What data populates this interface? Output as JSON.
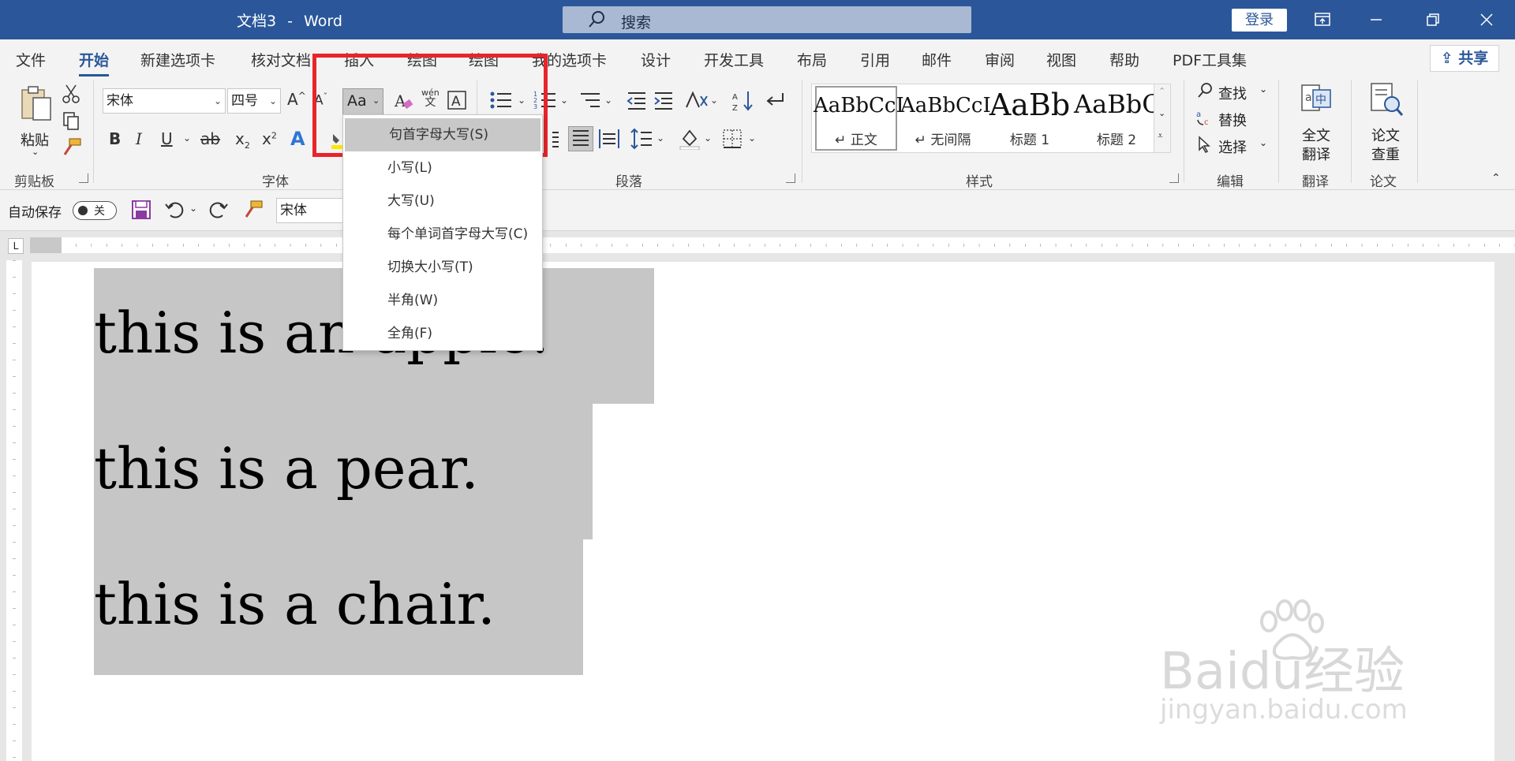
{
  "titlebar": {
    "doc_name": "文档3",
    "separator": "-",
    "app": "Word",
    "search_label": "搜索",
    "login": "登录"
  },
  "tabs": [
    {
      "label": "文件"
    },
    {
      "label": "开始"
    },
    {
      "label": "新建选项卡"
    },
    {
      "label": "核对文档"
    },
    {
      "label": "插入"
    },
    {
      "label": "绘图"
    },
    {
      "label": "绘图"
    },
    {
      "label": "我的选项卡"
    },
    {
      "label": "设计"
    },
    {
      "label": "开发工具"
    },
    {
      "label": "布局"
    },
    {
      "label": "引用"
    },
    {
      "label": "邮件"
    },
    {
      "label": "审阅"
    },
    {
      "label": "视图"
    },
    {
      "label": "帮助"
    },
    {
      "label": "PDF工具集"
    }
  ],
  "share": "共享",
  "ribbon": {
    "clipboard": {
      "paste": "粘贴",
      "group": "剪贴板"
    },
    "font": {
      "name": "宋体",
      "size": "四号",
      "group": "字体",
      "case_button": "Aa"
    },
    "paragraph": {
      "group": "段落"
    },
    "styles": {
      "group": "样式",
      "items": [
        {
          "preview": "AaBbCcI",
          "name": "正文"
        },
        {
          "preview": "AaBbCcI",
          "name": "无间隔"
        },
        {
          "preview": "AaBb",
          "name": "标题 1"
        },
        {
          "preview": "AaBbC",
          "name": "标题 2"
        }
      ]
    },
    "editing": {
      "find": "查找",
      "replace": "替换",
      "select": "选择",
      "group": "编辑"
    },
    "translate": {
      "label1": "全文",
      "label2": "翻译",
      "group": "翻译"
    },
    "paper": {
      "label1": "论文",
      "label2": "查重",
      "group": "论文"
    }
  },
  "qat": {
    "autosave": "自动保存",
    "toggle": "关",
    "font": "宋体"
  },
  "case_menu": [
    {
      "label": "句首字母大写(S)"
    },
    {
      "label": "小写(L)"
    },
    {
      "label": "大写(U)"
    },
    {
      "label": "每个单词首字母大写(C)"
    },
    {
      "label": "切换大小写(T)"
    },
    {
      "label": "半角(W)"
    },
    {
      "label": "全角(F)"
    }
  ],
  "document": {
    "lines": [
      "this is an apple.",
      "this is a pear.",
      "this is a chair."
    ]
  },
  "watermark": {
    "brand": "Baidu经验",
    "url": "jingyan.baidu.com"
  },
  "colors": {
    "accent": "#2b579a",
    "highlight_border": "#e8252a",
    "selection": "#c6c6c6"
  }
}
